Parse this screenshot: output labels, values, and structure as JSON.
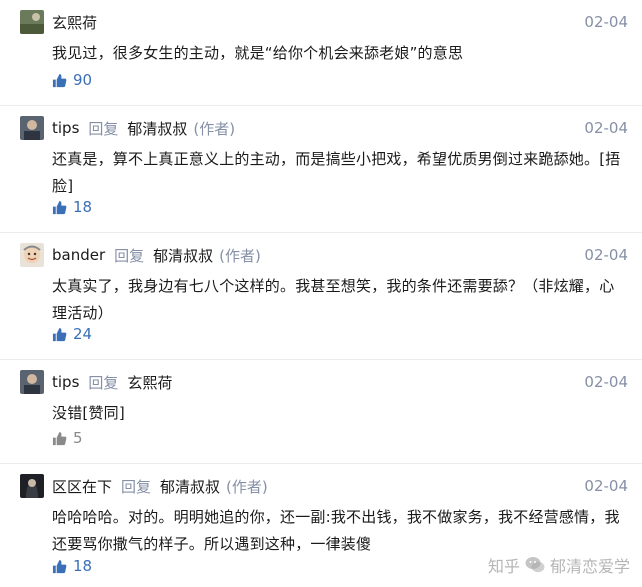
{
  "comments": [
    {
      "name": "玄熙荷",
      "reply_word": "",
      "reply_to": "",
      "author_tag": "",
      "date": "02-04",
      "text": "我见过，很多女生的主动，就是“给你个机会来舔老娘”的意思",
      "likes": "90",
      "likes_color": "#3b6fb6",
      "avatar": "avatar-photo-landscape"
    },
    {
      "name": "tips",
      "reply_word": "回复",
      "reply_to": "郁清叔叔",
      "author_tag": "(作者)",
      "date": "02-04",
      "text": "还真是，算不上真正意义上的主动，而是搞些小把戏，希望优质男倒过来跪舔她。[捂脸]",
      "likes": "18",
      "likes_color": "#3b6fb6",
      "avatar": "avatar-photo-person"
    },
    {
      "name": "bander",
      "reply_word": "回复",
      "reply_to": "郁清叔叔",
      "author_tag": "(作者)",
      "date": "02-04",
      "text": "太真实了，我身边有七八个这样的。我甚至想笑，我的条件还需要舔？（非炫耀，心理活动）",
      "likes": "24",
      "likes_color": "#3b6fb6",
      "avatar": "avatar-cartoon-face"
    },
    {
      "name": "tips",
      "reply_word": "回复",
      "reply_to": "玄熙荷",
      "author_tag": "",
      "date": "02-04",
      "text": "没错[赞同]",
      "likes": "5",
      "likes_color": "#8a8a8a",
      "avatar": "avatar-photo-person"
    },
    {
      "name": "区区在下",
      "reply_word": "回复",
      "reply_to": "郁清叔叔",
      "author_tag": "(作者)",
      "date": "02-04",
      "text": "哈哈哈哈。对的。明明她追的你，还一副:我不出钱，我不做家务，我不经营感情，我还要骂你撒气的样子。所以遇到这种，一律装傻",
      "likes": "18",
      "likes_color": "#3b6fb6",
      "avatar": "avatar-photo-dark"
    }
  ],
  "icons": {
    "like": "thumbs-up-icon"
  },
  "watermark": {
    "left": "知乎",
    "right": "郁清恋爱学"
  }
}
